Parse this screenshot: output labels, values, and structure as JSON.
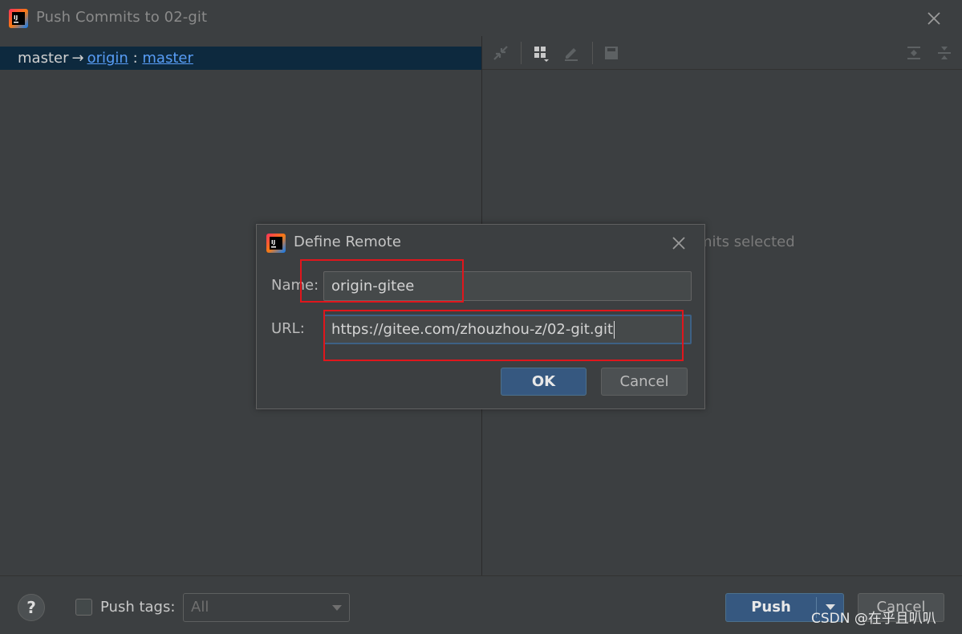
{
  "window": {
    "title": "Push Commits to 02-git"
  },
  "branch": {
    "local": "master",
    "arrow": "→",
    "remote": "origin",
    "separator": ":",
    "remote_branch": "master"
  },
  "details": {
    "empty_text": "mits selected"
  },
  "dialog": {
    "title": "Define Remote",
    "name_label": "Name:",
    "name_value": "origin-gitee",
    "url_label": "URL:",
    "url_value": "https://gitee.com/zhouzhou-z/02-git.git",
    "ok_label": "OK",
    "cancel_label": "Cancel"
  },
  "bottom": {
    "help_label": "?",
    "push_tags_label": "Push tags:",
    "push_tags_checked": false,
    "tags_combo_value": "All",
    "push_label": "Push",
    "cancel_label": "Cancel",
    "watermark": "CSDN @在乎且叭叭"
  },
  "colors": {
    "background": "#3c3f41",
    "selection": "#0d293e",
    "link": "#589df6",
    "primary_button": "#365880",
    "annotation": "#e0161c"
  },
  "icons": {
    "app": "intellij-idea-icon",
    "close": "close-icon",
    "toolbar": [
      "collapse-icon",
      "group-by-icon",
      "edit-icon",
      "save-icon",
      "expand-all-icon",
      "collapse-all-icon"
    ]
  }
}
